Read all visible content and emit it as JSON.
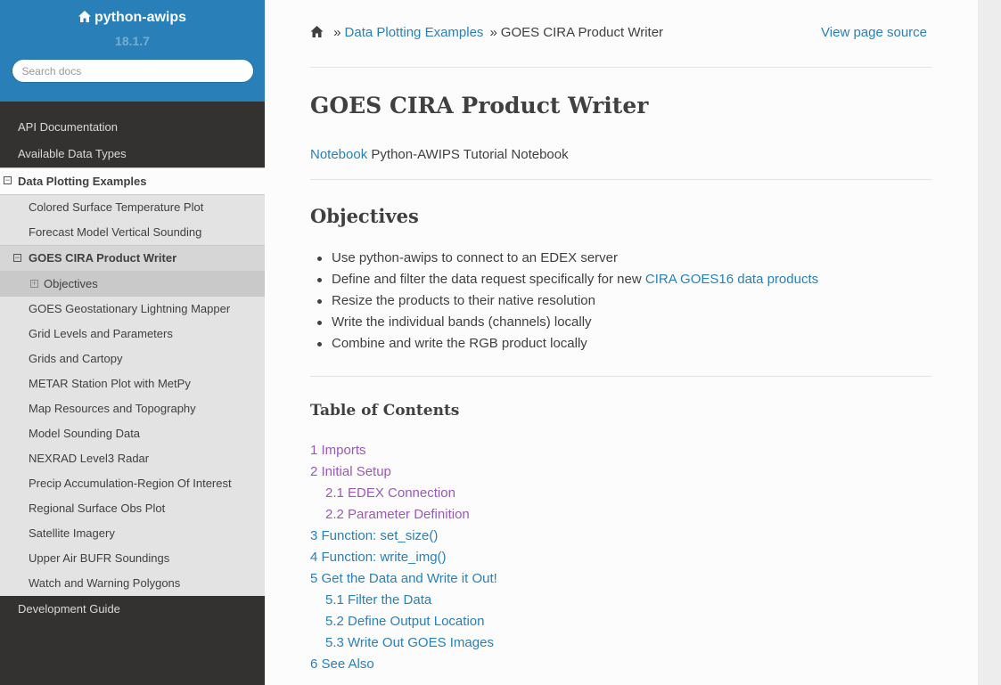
{
  "sidebar": {
    "project": "python-awips",
    "version": "18.1.7",
    "search_placeholder": "Search docs",
    "nav": [
      {
        "label": "API Documentation"
      },
      {
        "label": "Available Data Types"
      },
      {
        "label": "Data Plotting Examples"
      }
    ],
    "examples": [
      "Colored Surface Temperature Plot",
      "Forecast Model Vertical Sounding",
      "GOES CIRA Product Writer",
      "GOES Geostationary Lightning Mapper",
      "Grid Levels and Parameters",
      "Grids and Cartopy",
      "METAR Station Plot with MetPy",
      "Map Resources and Topography",
      "Model Sounding Data",
      "NEXRAD Level3 Radar",
      "Precip Accumulation-Region Of Interest",
      "Regional Surface Obs Plot",
      "Satellite Imagery",
      "Upper Air BUFR Soundings",
      "Watch and Warning Polygons"
    ],
    "current_sub": "Objectives",
    "after": "Development Guide",
    "toggle_minus": "−",
    "toggle_plus": "+"
  },
  "breadcrumbs": {
    "sep": "»",
    "parent": "Data Plotting Examples",
    "current": "GOES CIRA Product Writer",
    "view_source": "View page source"
  },
  "page": {
    "title": "GOES CIRA Product Writer",
    "notebook_link": "Notebook",
    "notebook_text": "Python-AWIPS Tutorial Notebook"
  },
  "objectives": {
    "heading": "Objectives",
    "items": [
      {
        "text": "Use python-awips to connect to an EDEX server",
        "link": ""
      },
      {
        "text": "Define and filter the data request specifically for new ",
        "link": "CIRA GOES16 data products"
      },
      {
        "text": "Resize the products to their native resolution",
        "link": ""
      },
      {
        "text": "Write the individual bands (channels) locally",
        "link": ""
      },
      {
        "text": "Combine and write the RGB product locally",
        "link": ""
      }
    ]
  },
  "toc": {
    "heading": "Table of Contents",
    "items": [
      {
        "label": "1 Imports",
        "visited": true,
        "sub": false
      },
      {
        "label": "2 Initial Setup",
        "visited": true,
        "sub": false
      },
      {
        "label": "2.1 EDEX Connection",
        "visited": true,
        "sub": true
      },
      {
        "label": "2.2 Parameter Definition",
        "visited": true,
        "sub": true
      },
      {
        "label": "3 Function: set_size()",
        "visited": false,
        "sub": false
      },
      {
        "label": "4 Function: write_img()",
        "visited": false,
        "sub": false
      },
      {
        "label": "5 Get the Data and Write it Out!",
        "visited": false,
        "sub": false
      },
      {
        "label": "5.1 Filter the Data",
        "visited": false,
        "sub": true
      },
      {
        "label": "5.2 Define Output Location",
        "visited": false,
        "sub": true
      },
      {
        "label": "5.3 Write Out GOES Images",
        "visited": false,
        "sub": true
      },
      {
        "label": "6 See Also",
        "visited": false,
        "sub": false
      }
    ]
  },
  "colors": {
    "brand": "#2980b9",
    "sidebar_bg": "#343131",
    "link_visited": "#9b59b6",
    "text": "#404040"
  }
}
